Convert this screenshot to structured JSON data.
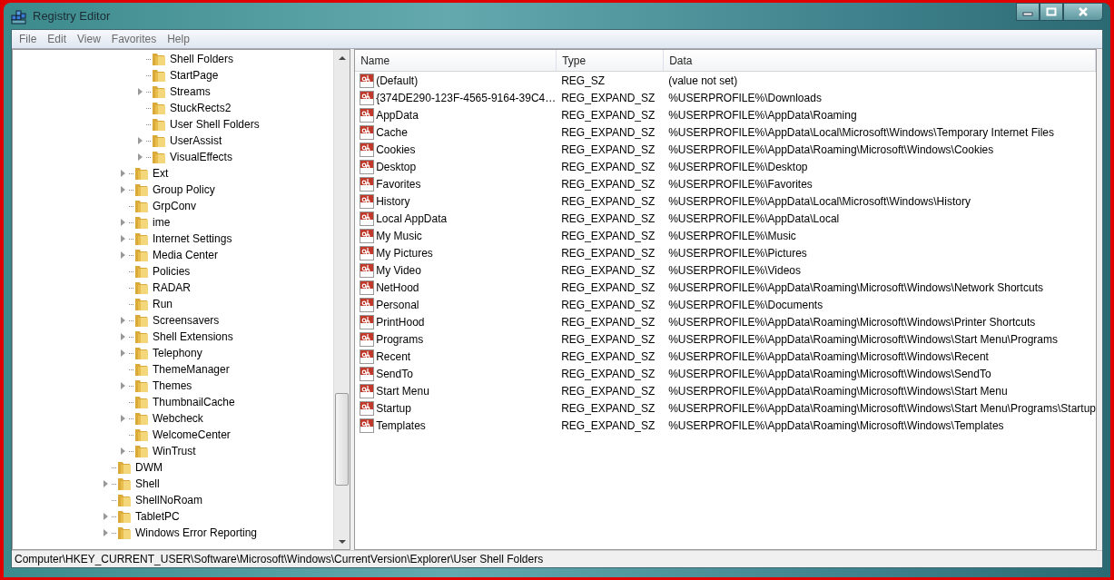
{
  "window": {
    "title": "Registry Editor"
  },
  "menu": [
    "File",
    "Edit",
    "View",
    "Favorites",
    "Help"
  ],
  "tree": [
    {
      "children": [
        {
          "children": [
            {
              "label": "Shell Folders",
              "expandable": false
            },
            {
              "label": "StartPage",
              "expandable": false
            },
            {
              "label": "Streams",
              "expandable": true
            },
            {
              "label": "StuckRects2",
              "expandable": false
            },
            {
              "label": "User Shell Folders",
              "expandable": false
            },
            {
              "label": "UserAssist",
              "expandable": true
            },
            {
              "label": "VisualEffects",
              "expandable": true
            }
          ]
        },
        {
          "label": "Ext",
          "expandable": true
        },
        {
          "label": "Group Policy",
          "expandable": true
        },
        {
          "label": "GrpConv",
          "expandable": false
        },
        {
          "label": "ime",
          "expandable": true
        },
        {
          "label": "Internet Settings",
          "expandable": true
        },
        {
          "label": "Media Center",
          "expandable": true
        },
        {
          "label": "Policies",
          "expandable": false
        },
        {
          "label": "RADAR",
          "expandable": false
        },
        {
          "label": "Run",
          "expandable": false
        },
        {
          "label": "Screensavers",
          "expandable": true
        },
        {
          "label": "Shell Extensions",
          "expandable": true
        },
        {
          "label": "Telephony",
          "expandable": true
        },
        {
          "label": "ThemeManager",
          "expandable": false
        },
        {
          "label": "Themes",
          "expandable": true
        },
        {
          "label": "ThumbnailCache",
          "expandable": false
        },
        {
          "label": "Webcheck",
          "expandable": true
        },
        {
          "label": "WelcomeCenter",
          "expandable": false
        },
        {
          "label": "WinTrust",
          "expandable": true
        }
      ]
    },
    {
      "label": "DWM",
      "expandable": false
    },
    {
      "label": "Shell",
      "expandable": true
    },
    {
      "label": "ShellNoRoam",
      "expandable": false
    },
    {
      "label": "TabletPC",
      "expandable": true
    },
    {
      "label": "Windows Error Reporting",
      "expandable": true
    }
  ],
  "table": {
    "columns": [
      "Name",
      "Type",
      "Data"
    ],
    "rows": [
      [
        "(Default)",
        "REG_SZ",
        "(value not set)"
      ],
      [
        "{374DE290-123F-4565-9164-39C4…",
        "REG_EXPAND_SZ",
        "%USERPROFILE%\\Downloads"
      ],
      [
        "AppData",
        "REG_EXPAND_SZ",
        "%USERPROFILE%\\AppData\\Roaming"
      ],
      [
        "Cache",
        "REG_EXPAND_SZ",
        "%USERPROFILE%\\AppData\\Local\\Microsoft\\Windows\\Temporary Internet Files"
      ],
      [
        "Cookies",
        "REG_EXPAND_SZ",
        "%USERPROFILE%\\AppData\\Roaming\\Microsoft\\Windows\\Cookies"
      ],
      [
        "Desktop",
        "REG_EXPAND_SZ",
        "%USERPROFILE%\\Desktop"
      ],
      [
        "Favorites",
        "REG_EXPAND_SZ",
        "%USERPROFILE%\\Favorites"
      ],
      [
        "History",
        "REG_EXPAND_SZ",
        "%USERPROFILE%\\AppData\\Local\\Microsoft\\Windows\\History"
      ],
      [
        "Local AppData",
        "REG_EXPAND_SZ",
        "%USERPROFILE%\\AppData\\Local"
      ],
      [
        "My Music",
        "REG_EXPAND_SZ",
        "%USERPROFILE%\\Music"
      ],
      [
        "My Pictures",
        "REG_EXPAND_SZ",
        "%USERPROFILE%\\Pictures"
      ],
      [
        "My Video",
        "REG_EXPAND_SZ",
        "%USERPROFILE%\\Videos"
      ],
      [
        "NetHood",
        "REG_EXPAND_SZ",
        "%USERPROFILE%\\AppData\\Roaming\\Microsoft\\Windows\\Network Shortcuts"
      ],
      [
        "Personal",
        "REG_EXPAND_SZ",
        "%USERPROFILE%\\Documents"
      ],
      [
        "PrintHood",
        "REG_EXPAND_SZ",
        "%USERPROFILE%\\AppData\\Roaming\\Microsoft\\Windows\\Printer Shortcuts"
      ],
      [
        "Programs",
        "REG_EXPAND_SZ",
        "%USERPROFILE%\\AppData\\Roaming\\Microsoft\\Windows\\Start Menu\\Programs"
      ],
      [
        "Recent",
        "REG_EXPAND_SZ",
        "%USERPROFILE%\\AppData\\Roaming\\Microsoft\\Windows\\Recent"
      ],
      [
        "SendTo",
        "REG_EXPAND_SZ",
        "%USERPROFILE%\\AppData\\Roaming\\Microsoft\\Windows\\SendTo"
      ],
      [
        "Start Menu",
        "REG_EXPAND_SZ",
        "%USERPROFILE%\\AppData\\Roaming\\Microsoft\\Windows\\Start Menu"
      ],
      [
        "Startup",
        "REG_EXPAND_SZ",
        "%USERPROFILE%\\AppData\\Roaming\\Microsoft\\Windows\\Start Menu\\Programs\\Startup"
      ],
      [
        "Templates",
        "REG_EXPAND_SZ",
        "%USERPROFILE%\\AppData\\Roaming\\Microsoft\\Windows\\Templates"
      ]
    ]
  },
  "status_bar": "Computer\\HKEY_CURRENT_USER\\Software\\Microsoft\\Windows\\CurrentVersion\\Explorer\\User Shell Folders"
}
